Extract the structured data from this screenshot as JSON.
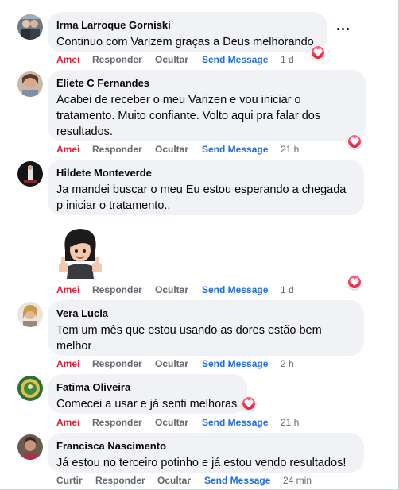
{
  "comments": [
    {
      "author": "Irma Larroque Gorniski",
      "text": "Continuo com Varizem graças a Deus melhorando",
      "actions": {
        "like": "Amei",
        "reply": "Responder",
        "hide": "Ocultar",
        "send": "Send Message",
        "time": "1 d"
      }
    },
    {
      "author": "Eliete C Fernandes",
      "text": "Acabei de receber o meu Varizen e vou iniciar o tratamento. Muito confiante. Volto aqui pra falar dos resultados.",
      "actions": {
        "like": "Amei",
        "reply": "Responder",
        "hide": "Ocultar",
        "send": "Send Message",
        "time": "21 h"
      }
    },
    {
      "author": "Hildete Monteverde",
      "text": "Ja mandei buscar o meu Eu estou esperando a chegada p iniciar o tratamento..",
      "actions": {
        "like": "Amei",
        "reply": "Responder",
        "hide": "Ocultar",
        "send": "Send Message",
        "time": "1 d"
      },
      "sticker": "avatar-thumbs-up-sticker"
    },
    {
      "author": "Vera Lucia",
      "text": "Tem um mês que estou usando as dores estão bem melhor",
      "actions": {
        "like": "Amei",
        "reply": "Responder",
        "hide": "Ocultar",
        "send": "Send Message",
        "time": "2 h"
      }
    },
    {
      "author": "Fatima Oliveira",
      "text": "Comecei a usar e já senti melhoras",
      "actions": {
        "like": "Amei",
        "reply": "Responder",
        "hide": "Ocultar",
        "send": "Send Message",
        "time": "21 h"
      }
    },
    {
      "author": "Francisca Nascimento",
      "text": "Já estou no terceiro potinho e já estou vendo resultados!",
      "actions": {
        "like": "Curtir",
        "reply": "Responder",
        "hide": "Ocultar",
        "send": "Send Message",
        "time": "24 min"
      }
    }
  ],
  "icons": {
    "reaction": "heart-love-icon",
    "menu": "more-options-icon"
  },
  "colors": {
    "liked": "#e41e3f",
    "send_link": "#216fdb",
    "muted": "#65676b",
    "bubble": "#f0f2f5"
  }
}
